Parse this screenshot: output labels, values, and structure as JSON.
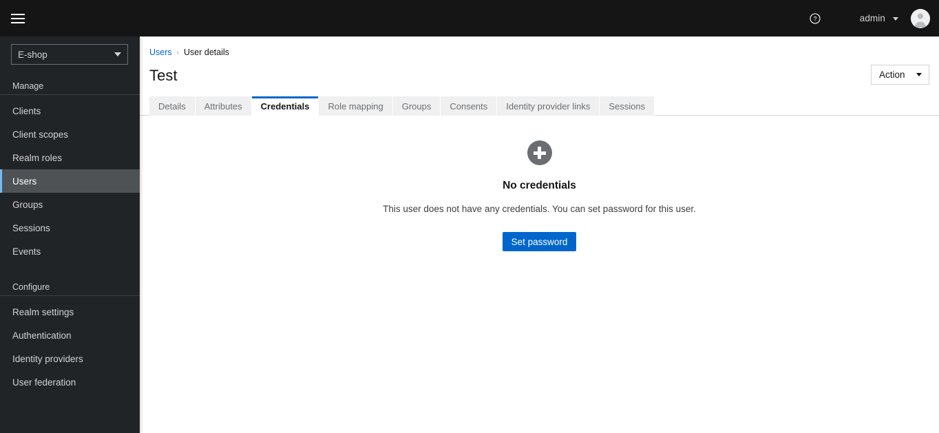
{
  "masthead": {
    "menu_toggle": "Toggle navigation",
    "help_icon": "help-circle-icon",
    "username": "admin",
    "avatar_alt": "User avatar"
  },
  "sidebar": {
    "realm_selector": {
      "selected": "E-shop",
      "caret_icon": "caret-down-icon"
    },
    "sections": [
      {
        "title": "Manage",
        "items": [
          {
            "label": "Clients",
            "active": false
          },
          {
            "label": "Client scopes",
            "active": false
          },
          {
            "label": "Realm roles",
            "active": false
          },
          {
            "label": "Users",
            "active": true
          },
          {
            "label": "Groups",
            "active": false
          },
          {
            "label": "Sessions",
            "active": false
          },
          {
            "label": "Events",
            "active": false
          }
        ]
      },
      {
        "title": "Configure",
        "items": [
          {
            "label": "Realm settings",
            "active": false
          },
          {
            "label": "Authentication",
            "active": false
          },
          {
            "label": "Identity providers",
            "active": false
          },
          {
            "label": "User federation",
            "active": false
          }
        ]
      }
    ]
  },
  "main": {
    "breadcrumb": {
      "parent": "Users",
      "separator": "›",
      "current": "User details"
    },
    "title": "Test",
    "action_dropdown": {
      "label": "Action",
      "caret_icon": "caret-down-icon"
    },
    "tabs": [
      {
        "label": "Details",
        "active": false
      },
      {
        "label": "Attributes",
        "active": false
      },
      {
        "label": "Credentials",
        "active": true
      },
      {
        "label": "Role mapping",
        "active": false
      },
      {
        "label": "Groups",
        "active": false
      },
      {
        "label": "Consents",
        "active": false
      },
      {
        "label": "Identity provider links",
        "active": false
      },
      {
        "label": "Sessions",
        "active": false
      }
    ],
    "empty_state": {
      "icon": "plus-circle-icon",
      "title": "No credentials",
      "body": "This user does not have any credentials. You can set password for this user.",
      "primary_button": "Set password"
    }
  },
  "colors": {
    "masthead_bg": "#151515",
    "sidebar_bg": "#212427",
    "nav_active_bg": "#4f5255",
    "nav_active_accent": "#73bcf7",
    "link_blue": "#06c",
    "primary_button": "#06c",
    "tab_inactive_bg": "#f0f0f0",
    "empty_icon_grey": "#6a6e73",
    "border_grey": "#d2d2d2"
  }
}
